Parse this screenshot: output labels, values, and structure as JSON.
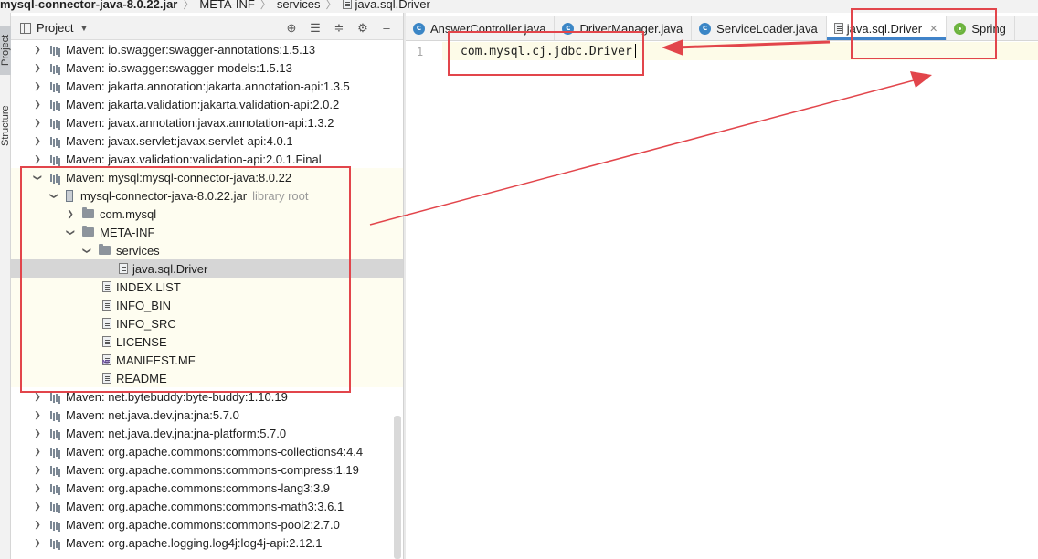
{
  "breadcrumb": {
    "items": [
      "mysql-connector-java-8.0.22.jar",
      "META-INF",
      "services",
      "java.sql.Driver"
    ]
  },
  "left_strip": {
    "tabs": [
      "Project",
      "Structure"
    ]
  },
  "project_panel": {
    "title": "Project",
    "header_icons": [
      "target-icon",
      "collapse-icon",
      "expand-icon",
      "gear-icon",
      "minimize-icon"
    ]
  },
  "tree": {
    "rows": [
      {
        "label": "Maven: io.swagger:swagger-annotations:1.5.13"
      },
      {
        "label": "Maven: io.swagger:swagger-models:1.5.13"
      },
      {
        "label": "Maven: jakarta.annotation:jakarta.annotation-api:1.3.5"
      },
      {
        "label": "Maven: jakarta.validation:jakarta.validation-api:2.0.2"
      },
      {
        "label": "Maven: javax.annotation:javax.annotation-api:1.3.2"
      },
      {
        "label": "Maven: javax.servlet:javax.servlet-api:4.0.1"
      },
      {
        "label": "Maven: javax.validation:validation-api:2.0.1.Final"
      },
      {
        "label": "Maven: mysql:mysql-connector-java:8.0.22"
      },
      {
        "label": "mysql-connector-java-8.0.22.jar",
        "suffix": "library root"
      },
      {
        "label": "com.mysql"
      },
      {
        "label": "META-INF"
      },
      {
        "label": "services"
      },
      {
        "label": "java.sql.Driver"
      },
      {
        "label": "INDEX.LIST"
      },
      {
        "label": "INFO_BIN"
      },
      {
        "label": "INFO_SRC"
      },
      {
        "label": "LICENSE"
      },
      {
        "label": "MANIFEST.MF"
      },
      {
        "label": "README"
      },
      {
        "label": "Maven: net.bytebuddy:byte-buddy:1.10.19"
      },
      {
        "label": "Maven: net.java.dev.jna:jna:5.7.0"
      },
      {
        "label": "Maven: net.java.dev.jna:jna-platform:5.7.0"
      },
      {
        "label": "Maven: org.apache.commons:commons-collections4:4.4"
      },
      {
        "label": "Maven: org.apache.commons:commons-compress:1.19"
      },
      {
        "label": "Maven: org.apache.commons:commons-lang3:3.9"
      },
      {
        "label": "Maven: org.apache.commons:commons-math3:3.6.1"
      },
      {
        "label": "Maven: org.apache.commons:commons-pool2:2.7.0"
      },
      {
        "label": "Maven: org.apache.logging.log4j:log4j-api:2.12.1"
      }
    ]
  },
  "editor_tabs": [
    {
      "label": "AnswerController.java",
      "icon": "class-icon"
    },
    {
      "label": "DriverManager.java",
      "icon": "class-icon"
    },
    {
      "label": "ServiceLoader.java",
      "icon": "class-icon"
    },
    {
      "label": "java.sql.Driver",
      "icon": "text-file-icon",
      "active": true
    },
    {
      "label": "Spring",
      "icon": "spring-icon"
    }
  ],
  "editor": {
    "line_number": "1",
    "code": "com.mysql.cj.jdbc.Driver"
  },
  "colors": {
    "annotation_red": "#e2454b",
    "tab_accent": "#4083c9",
    "selection": "#d6d6d6",
    "highlight_bg": "#fefdf0"
  }
}
